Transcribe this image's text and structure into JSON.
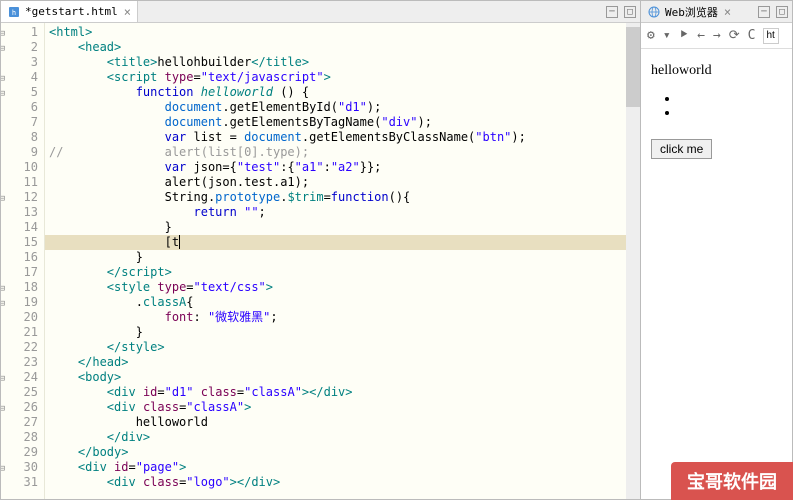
{
  "editor": {
    "tab": {
      "name": "*getstart.html",
      "icon": "html-file"
    },
    "lines": [
      {
        "n": 1,
        "f": "-",
        "html": "<span class='tag'>&lt;html&gt;</span>"
      },
      {
        "n": 2,
        "f": "-",
        "html": "    <span class='tag'>&lt;head&gt;</span>"
      },
      {
        "n": 3,
        "f": "",
        "html": "        <span class='tag'>&lt;title&gt;</span>hellohbuilder<span class='tag'>&lt;/title&gt;</span>"
      },
      {
        "n": 4,
        "f": "-",
        "html": "        <span class='tag'>&lt;script</span> <span class='attr'>type</span>=<span class='str'>\"text/javascript\"</span><span class='tag'>&gt;</span>"
      },
      {
        "n": 5,
        "f": "-",
        "html": "            <span class='kw'>function</span> <span class='fn'>helloworld</span> () {"
      },
      {
        "n": 6,
        "f": "",
        "html": "                <span class='prop'>document</span>.getElementById(<span class='str'>\"d1\"</span>);"
      },
      {
        "n": 7,
        "f": "",
        "html": "                <span class='prop'>document</span>.getElementsByTagName(<span class='str'>\"div\"</span>);"
      },
      {
        "n": 8,
        "f": "",
        "html": "                <span class='kw'>var</span> list = <span class='prop'>document</span>.getElementsByClassName(<span class='str'>\"btn\"</span>);"
      },
      {
        "n": 9,
        "f": "",
        "html": "<span class='cm'>//              alert(list[0].type);</span>"
      },
      {
        "n": 10,
        "f": "",
        "html": "                <span class='kw'>var</span> json={<span class='str'>\"test\"</span>:{<span class='str'>\"a1\"</span>:<span class='str'>\"a2\"</span>}};"
      },
      {
        "n": 11,
        "f": "",
        "html": "                alert(json.test.a1);"
      },
      {
        "n": 12,
        "f": "-",
        "html": "                String.<span class='prop'>prototype</span>.<span class='teal'>$trim</span>=<span class='kw'>function</span>(){"
      },
      {
        "n": 13,
        "f": "",
        "html": "                    <span class='kw'>return</span> <span class='str'>\"\"</span>;"
      },
      {
        "n": 14,
        "f": "",
        "html": "                }"
      },
      {
        "n": 15,
        "f": "",
        "html": "                [t<span class='cursor'></span>",
        "hl": true
      },
      {
        "n": 16,
        "f": "",
        "html": "            }"
      },
      {
        "n": 17,
        "f": "",
        "html": "        <span class='tag'>&lt;/script&gt;</span>"
      },
      {
        "n": 18,
        "f": "-",
        "html": "        <span class='tag'>&lt;style</span> <span class='attr'>type</span>=<span class='str'>\"text/css\"</span><span class='tag'>&gt;</span>"
      },
      {
        "n": 19,
        "f": "-",
        "html": "            .<span class='teal'>classA</span>{"
      },
      {
        "n": 20,
        "f": "",
        "html": "                <span class='attr'>font</span>: <span class='str'>\"微软雅黑\"</span>;"
      },
      {
        "n": 21,
        "f": "",
        "html": "            }"
      },
      {
        "n": 22,
        "f": "",
        "html": "        <span class='tag'>&lt;/style&gt;</span>"
      },
      {
        "n": 23,
        "f": "",
        "html": "    <span class='tag'>&lt;/head&gt;</span>"
      },
      {
        "n": 24,
        "f": "-",
        "html": "    <span class='tag'>&lt;body&gt;</span>"
      },
      {
        "n": 25,
        "f": "",
        "html": "        <span class='tag'>&lt;div</span> <span class='attr'>id</span>=<span class='str'>\"d1\"</span> <span class='attr'>class</span>=<span class='str'>\"classA\"</span><span class='tag'>&gt;&lt;/div&gt;</span>"
      },
      {
        "n": 26,
        "f": "-",
        "html": "        <span class='tag'>&lt;div</span> <span class='attr'>class</span>=<span class='str'>\"classA\"</span><span class='tag'>&gt;</span>"
      },
      {
        "n": 27,
        "f": "",
        "html": "            helloworld"
      },
      {
        "n": 28,
        "f": "",
        "html": "        <span class='tag'>&lt;/div&gt;</span>"
      },
      {
        "n": 29,
        "f": "",
        "html": "    <span class='tag'>&lt;/body&gt;</span>"
      },
      {
        "n": 30,
        "f": "-",
        "html": "    <span class='tag'>&lt;div</span> <span class='attr'>id</span>=<span class='str'>\"page\"</span><span class='tag'>&gt;</span>"
      },
      {
        "n": 31,
        "f": "",
        "html": "        <span class='tag'>&lt;div</span> <span class='attr'>class</span>=<span class='str'>\"logo\"</span><span class='tag'>&gt;&lt;/div&gt;</span>"
      }
    ]
  },
  "browser": {
    "tab": {
      "name": "Web浏览器",
      "icon": "globe"
    },
    "url_frag": "ht",
    "content": {
      "heading": "helloworld",
      "button": "click me"
    }
  },
  "watermark": "宝哥软件园"
}
